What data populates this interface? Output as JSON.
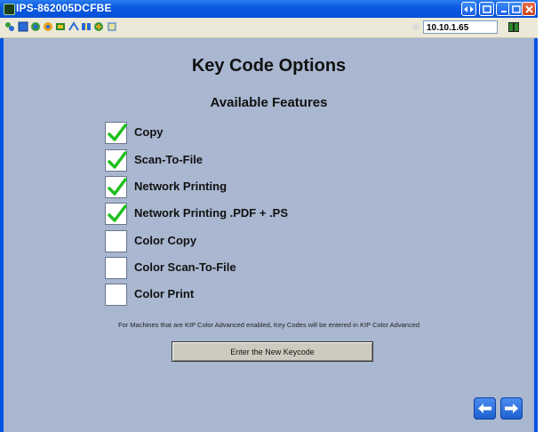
{
  "window": {
    "title": "IPS-862005DCFBE"
  },
  "toolbar": {
    "ip_address": "10.10.1.65"
  },
  "page": {
    "heading": "Key Code Options",
    "subheading": "Available Features"
  },
  "features": [
    {
      "label": "Copy",
      "checked": true
    },
    {
      "label": "Scan-To-File",
      "checked": true
    },
    {
      "label": "Network Printing",
      "checked": true
    },
    {
      "label": "Network Printing .PDF + .PS",
      "checked": true
    },
    {
      "label": "Color Copy",
      "checked": false
    },
    {
      "label": "Color Scan-To-File",
      "checked": false
    },
    {
      "label": "Color Print",
      "checked": false
    }
  ],
  "note": "For Machines that are KIP Color Advanced enabled, Key Codes will be entered in KIP Color Advanced",
  "enter_button": {
    "label": "Enter the New Keycode"
  },
  "colors": {
    "window_frame": "#0054e3",
    "content_bg": "#a9b7d0",
    "check_green": "#1fbf1f",
    "nav_button": "#2c6fe0"
  }
}
